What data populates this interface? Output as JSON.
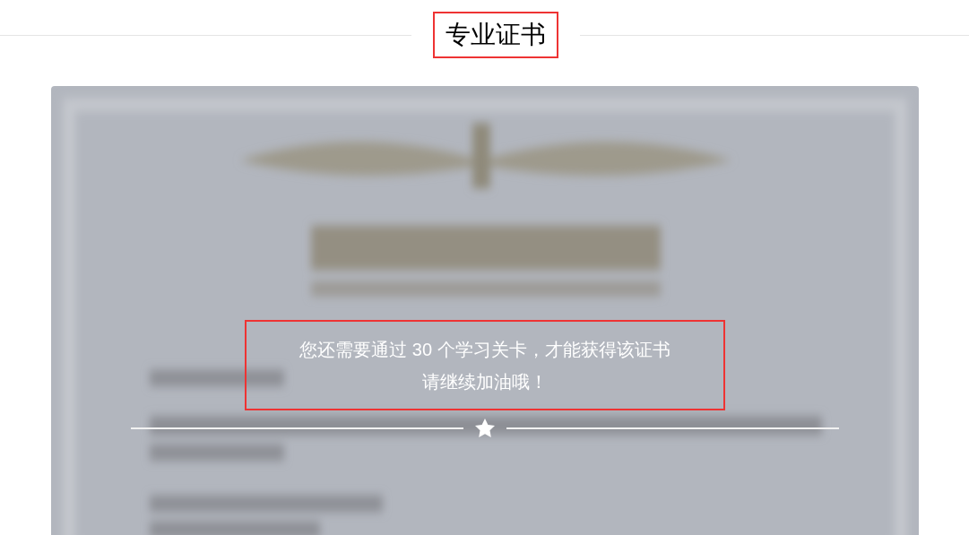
{
  "section_title": "专业证书",
  "certificate": {
    "kind": "picture",
    "message_lines": [
      "您还需要通过 30 个学习关卡，才能获得该证书",
      "请继续加油哦！"
    ]
  }
}
